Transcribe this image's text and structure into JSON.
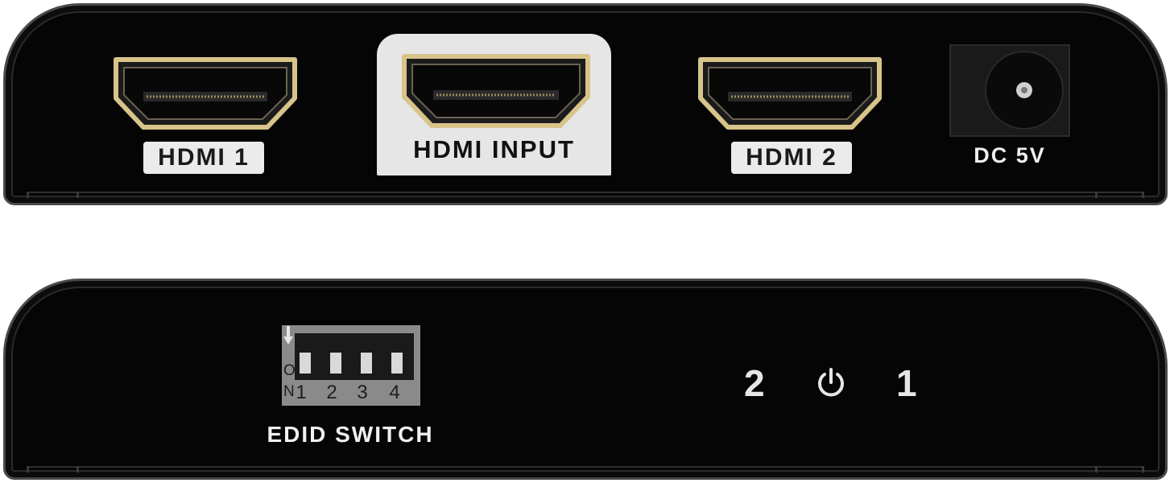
{
  "rear_panel": {
    "port_hdmi_1": "HDMI 1",
    "port_hdmi_input": "HDMI INPUT",
    "port_hdmi_2": "HDMI 2",
    "power_jack": "DC 5V"
  },
  "front_panel": {
    "dip_switch": {
      "on_label": "ON",
      "positions": [
        "1",
        "2",
        "3",
        "4"
      ]
    },
    "edid_label": "EDID SWITCH",
    "led_2": "2",
    "led_1": "1",
    "power_led_icon": "power-icon"
  },
  "colors": {
    "chassis": "#050505",
    "port_gold": "#d8c48a",
    "label_bg": "#ebebeb"
  }
}
